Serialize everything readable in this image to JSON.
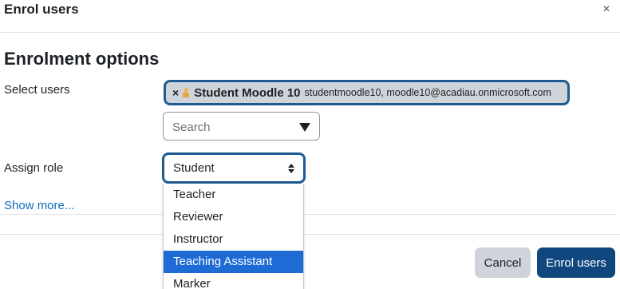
{
  "modal": {
    "title": "Enrol users",
    "close_symbol": "×",
    "close_icon": "close-icon"
  },
  "form": {
    "section_heading": "Enrolment options",
    "select_users_label": "Select users",
    "selected_user": {
      "remove_symbol": "×",
      "icon": "user-icon",
      "name": "Student Moodle 10",
      "detail": "studentmoodle10, moodle10@acadiau.onmicrosoft.com"
    },
    "search": {
      "placeholder": "Search",
      "icon": "caret-down-icon"
    },
    "assign_role_label": "Assign role",
    "role_select": {
      "value": "Student",
      "icon": "up-down-arrows-icon",
      "options": [
        "Teacher",
        "Reviewer",
        "Instructor",
        "Teaching Assistant",
        "Marker"
      ],
      "highlighted_option": "Teaching Assistant"
    },
    "show_more": "Show more..."
  },
  "footer": {
    "cancel_label": "Cancel",
    "enrol_label": "Enrol users"
  },
  "colors": {
    "focus_border": "#1f5a93",
    "chip_background": "#ced4da",
    "primary_button": "#0f477e",
    "link": "#0f6cbf",
    "option_highlight": "#1e6bd6"
  }
}
